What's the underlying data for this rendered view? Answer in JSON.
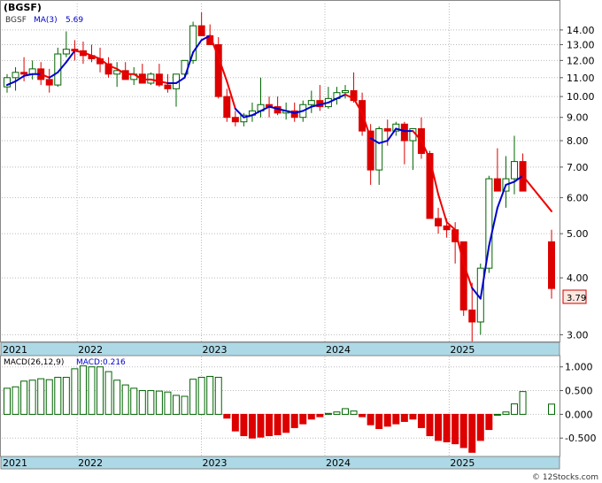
{
  "chart_data": [
    {
      "type": "candlestick",
      "title": "(BGSF)",
      "legend": {
        "ticker": "BGSF",
        "ma_label": "MA(3)",
        "ma_value": "5.69"
      },
      "y_scale": "log",
      "ylim": [
        2.9,
        16.0
      ],
      "y_ticks": [
        "14.00",
        "13.00",
        "12.00",
        "11.00",
        "10.00",
        "9.00",
        "8.00",
        "7.00",
        "6.00",
        "5.00",
        "4.00",
        "3.00"
      ],
      "x_ticks": [
        "2021",
        "2022",
        "2023",
        "2024",
        "2025"
      ],
      "last_price": "3.79",
      "colors": {
        "up": "#006400",
        "down": "#dd0000",
        "ma_up": "#0000cc",
        "ma_down": "#ee0000",
        "axis_band": "#add8e6",
        "price_badge": "#fde8e0"
      },
      "candles": [
        [
          10.5,
          11.2,
          10.2,
          11.0
        ],
        [
          11.0,
          11.6,
          10.3,
          11.3
        ],
        [
          11.3,
          12.2,
          10.8,
          11.2
        ],
        [
          11.2,
          12.0,
          10.9,
          11.5
        ],
        [
          11.5,
          11.9,
          10.6,
          10.9
        ],
        [
          10.9,
          11.5,
          10.2,
          10.6
        ],
        [
          10.6,
          12.8,
          10.5,
          12.4
        ],
        [
          12.4,
          13.9,
          12.2,
          12.7
        ],
        [
          12.7,
          13.3,
          12.0,
          12.6
        ],
        [
          12.6,
          13.2,
          11.8,
          12.3
        ],
        [
          12.3,
          13.0,
          11.9,
          12.1
        ],
        [
          12.1,
          12.8,
          11.3,
          11.8
        ],
        [
          11.8,
          12.2,
          11.0,
          11.2
        ],
        [
          11.2,
          11.9,
          10.5,
          11.4
        ],
        [
          11.4,
          11.9,
          11.0,
          10.9
        ],
        [
          10.9,
          11.6,
          10.6,
          11.2
        ],
        [
          11.2,
          11.8,
          10.8,
          10.7
        ],
        [
          10.7,
          11.3,
          10.6,
          11.2
        ],
        [
          11.2,
          11.8,
          10.5,
          10.6
        ],
        [
          10.6,
          11.2,
          10.2,
          10.4
        ],
        [
          10.4,
          11.0,
          9.5,
          11.2
        ],
        [
          11.2,
          12.0,
          11.0,
          12.0
        ],
        [
          12.0,
          14.6,
          11.8,
          14.3
        ],
        [
          14.3,
          15.3,
          13.6,
          13.6
        ],
        [
          13.6,
          14.4,
          13.0,
          13.0
        ],
        [
          13.0,
          13.5,
          9.9,
          10.0
        ],
        [
          10.0,
          10.4,
          8.8,
          9.0
        ],
        [
          9.0,
          9.3,
          8.6,
          8.8
        ],
        [
          8.8,
          9.2,
          8.6,
          9.1
        ],
        [
          9.1,
          9.7,
          8.8,
          9.3
        ],
        [
          9.3,
          11.0,
          9.0,
          9.6
        ],
        [
          9.6,
          10.0,
          9.0,
          9.5
        ],
        [
          9.5,
          10.0,
          9.1,
          9.2
        ],
        [
          9.2,
          9.7,
          8.9,
          9.3
        ],
        [
          9.3,
          9.7,
          8.8,
          9.0
        ],
        [
          9.0,
          9.8,
          8.8,
          9.6
        ],
        [
          9.6,
          10.3,
          9.2,
          9.8
        ],
        [
          9.8,
          10.6,
          9.3,
          9.5
        ],
        [
          9.5,
          10.5,
          9.4,
          9.9
        ],
        [
          9.9,
          10.5,
          9.6,
          10.2
        ],
        [
          10.2,
          10.6,
          9.9,
          10.3
        ],
        [
          10.3,
          11.3,
          9.7,
          9.8
        ],
        [
          9.8,
          10.2,
          8.2,
          8.4
        ],
        [
          8.4,
          8.7,
          6.4,
          6.9
        ],
        [
          6.9,
          8.6,
          6.4,
          8.5
        ],
        [
          8.5,
          8.9,
          7.8,
          8.4
        ],
        [
          8.4,
          8.8,
          8.2,
          8.7
        ],
        [
          8.7,
          8.8,
          7.1,
          8.0
        ],
        [
          8.0,
          8.4,
          6.9,
          8.5
        ],
        [
          8.5,
          9.0,
          7.3,
          7.5
        ],
        [
          7.5,
          7.6,
          5.4,
          5.4
        ],
        [
          5.4,
          5.7,
          5.0,
          5.2
        ],
        [
          5.2,
          5.4,
          4.9,
          5.1
        ],
        [
          5.1,
          5.3,
          4.3,
          4.8
        ],
        [
          4.8,
          4.8,
          3.3,
          3.4
        ],
        [
          3.4,
          3.9,
          2.9,
          3.2
        ],
        [
          3.2,
          4.3,
          3.0,
          4.2
        ],
        [
          4.2,
          6.7,
          4.1,
          6.6
        ],
        [
          6.6,
          7.7,
          6.3,
          6.2
        ],
        [
          6.2,
          7.4,
          5.7,
          6.6
        ],
        [
          6.6,
          8.2,
          6.1,
          7.2
        ],
        [
          7.2,
          7.5,
          6.2,
          6.2
        ],
        [
          4.8,
          5.1,
          3.6,
          3.79
        ]
      ],
      "ma": [
        10.6,
        10.8,
        11.1,
        11.2,
        11.2,
        11.0,
        11.3,
        11.9,
        12.6,
        12.5,
        12.3,
        12.1,
        11.7,
        11.5,
        11.2,
        11.2,
        10.9,
        10.9,
        10.8,
        10.7,
        10.7,
        11.0,
        12.5,
        13.3,
        13.6,
        12.2,
        10.8,
        9.4,
        9.0,
        9.1,
        9.3,
        9.5,
        9.4,
        9.3,
        9.2,
        9.3,
        9.5,
        9.6,
        9.7,
        9.9,
        10.1,
        9.9,
        9.2,
        8.1,
        7.9,
        8.0,
        8.5,
        8.4,
        8.4,
        8.0,
        7.3,
        6.1,
        5.3,
        5.1,
        4.3,
        3.8,
        3.6,
        4.7,
        5.7,
        6.4,
        6.5,
        6.7,
        5.6
      ],
      "ma_direction": [
        "up",
        "up",
        "up",
        "up",
        "up",
        "down",
        "up",
        "up",
        "up",
        "down",
        "down",
        "down",
        "down",
        "down",
        "down",
        "down",
        "down",
        "down",
        "down",
        "down",
        "up",
        "up",
        "up",
        "up",
        "up",
        "down",
        "down",
        "down",
        "up",
        "up",
        "up",
        "up",
        "up",
        "up",
        "up",
        "up",
        "up",
        "up",
        "up",
        "up",
        "up",
        "down",
        "down",
        "down",
        "up",
        "up",
        "up",
        "up",
        "up",
        "down",
        "down",
        "down",
        "down",
        "down",
        "down",
        "down",
        "up",
        "up",
        "up",
        "up",
        "up",
        "up",
        "down"
      ]
    },
    {
      "type": "bar",
      "title": "MACD(26,12,9)",
      "legend": {
        "label": "MACD(26,12,9)",
        "value_label": "MACD:0.216"
      },
      "ylim": [
        -0.85,
        1.2
      ],
      "y_ticks": [
        "1.000",
        "0.500",
        "0.000",
        "-0.500"
      ],
      "x_ticks": [
        "2021",
        "2022",
        "2023",
        "2024",
        "2025"
      ],
      "values": [
        0.55,
        0.58,
        0.7,
        0.72,
        0.75,
        0.73,
        0.78,
        0.78,
        0.96,
        1.02,
        1.0,
        1.0,
        0.9,
        0.72,
        0.62,
        0.55,
        0.5,
        0.5,
        0.49,
        0.47,
        0.4,
        0.38,
        0.74,
        0.78,
        0.8,
        0.78,
        -0.08,
        -0.35,
        -0.45,
        -0.5,
        -0.48,
        -0.45,
        -0.43,
        -0.38,
        -0.28,
        -0.2,
        -0.1,
        -0.05,
        0.02,
        0.05,
        0.12,
        0.07,
        -0.05,
        -0.22,
        -0.3,
        -0.25,
        -0.2,
        -0.15,
        -0.1,
        -0.28,
        -0.45,
        -0.55,
        -0.58,
        -0.62,
        -0.7,
        -0.8,
        -0.55,
        -0.32,
        0.0,
        0.05,
        0.22,
        0.48,
        0.216
      ]
    }
  ],
  "footer": {
    "copyright": "© 12Stocks.com"
  }
}
